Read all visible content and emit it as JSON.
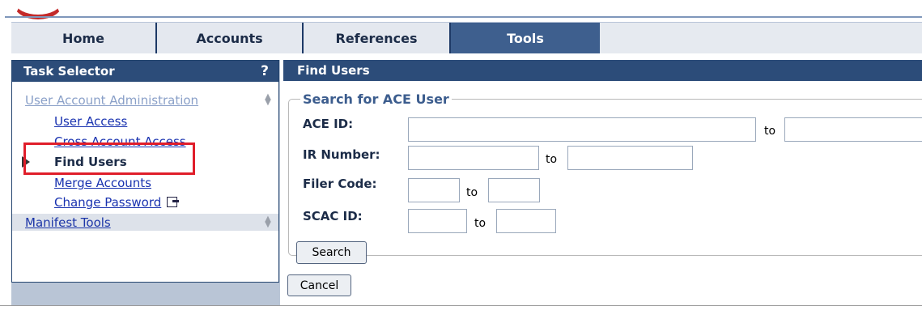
{
  "tabs": [
    "Home",
    "Accounts",
    "References",
    "Tools"
  ],
  "sidebar": {
    "title": "Task Selector",
    "help": "?",
    "category1": "User Account Administration",
    "items": [
      "User Access",
      "Cross Account Access",
      "Find Users",
      "Merge Accounts",
      "Change Password"
    ],
    "category2": "Manifest Tools"
  },
  "main": {
    "title": "Find Users",
    "group_title": "Search for ACE User",
    "fields": {
      "ace_id": "ACE ID:",
      "ir_number": "IR Number:",
      "filer_code": "Filer Code:",
      "scac_id": "SCAC ID:"
    },
    "to": "to",
    "search_button": "Search",
    "cancel_button": "Cancel"
  }
}
